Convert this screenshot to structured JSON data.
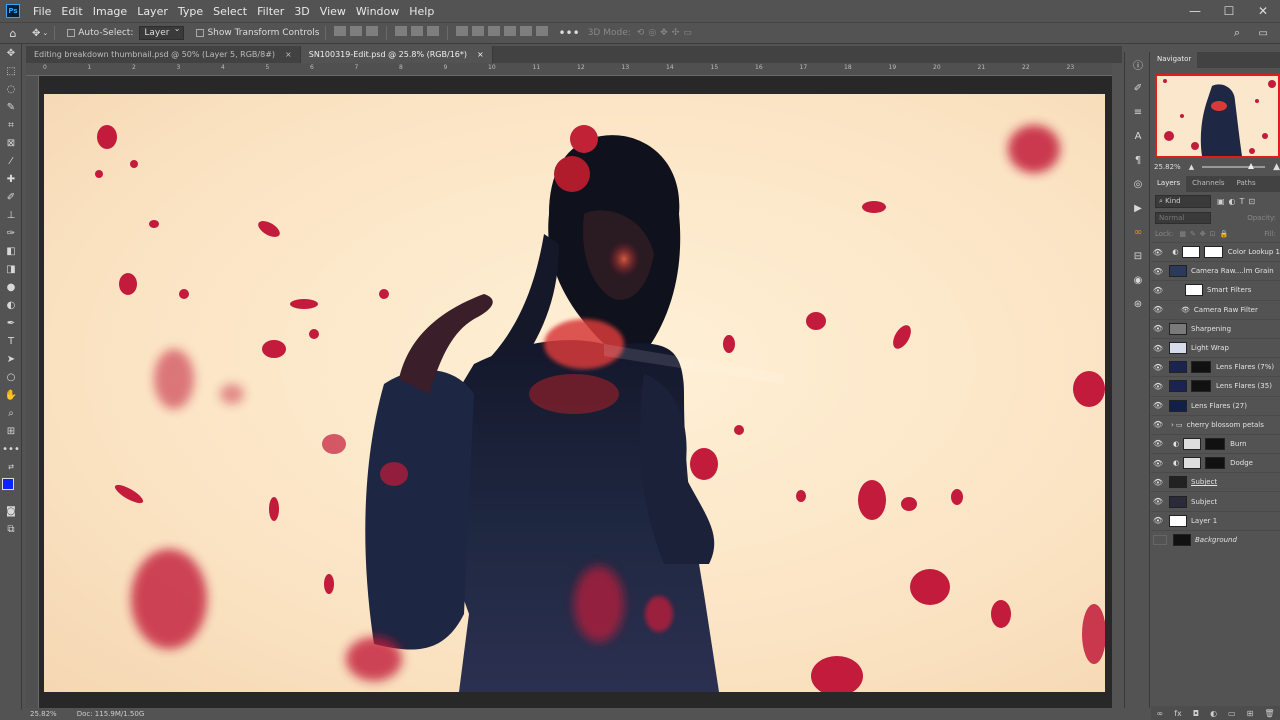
{
  "menu": [
    "File",
    "Edit",
    "Image",
    "Layer",
    "Type",
    "Select",
    "Filter",
    "3D",
    "View",
    "Window",
    "Help"
  ],
  "options": {
    "auto_select_label": "Auto-Select:",
    "auto_select_value": "Layer",
    "show_transform": "Show Transform Controls",
    "mode_3d": "3D Mode:"
  },
  "tabs": [
    {
      "label": "Editing breakdown thumbnail.psd @ 50% (Layer 5, RGB/8#)",
      "active": false
    },
    {
      "label": "SN100319-Edit.psd @ 25.8% (RGB/16*)",
      "active": true
    }
  ],
  "ruler_ticks": [
    "0",
    "1",
    "2",
    "3",
    "4",
    "5",
    "6",
    "7",
    "8",
    "9",
    "10",
    "11",
    "12",
    "13",
    "14",
    "15",
    "16",
    "17",
    "18",
    "19",
    "20",
    "21",
    "22",
    "23"
  ],
  "status": {
    "zoom": "25.82%",
    "doc": "Doc: 115.9M/1.50G"
  },
  "panels": {
    "navigator_tab": "Navigator",
    "zoom": "25.82%",
    "layer_tabs": [
      "Layers",
      "Channels",
      "Paths"
    ],
    "filter_kind": "Kind",
    "blend_mode": "Normal",
    "opacity_label": "Opacity:",
    "lock_label": "Lock:",
    "fill_label": "Fill:"
  },
  "layers": [
    {
      "name": "Color Lookup 1",
      "eye": true,
      "thumb": "#fff",
      "mask": "#fff",
      "adj": true
    },
    {
      "name": "Camera Raw....lm Grain",
      "eye": true,
      "thumb": "#2b3a5c",
      "mask": "",
      "adj": false
    },
    {
      "name": "Smart Filters",
      "eye": true,
      "thumb": "#fff",
      "mask": "",
      "adj": false,
      "indent": true
    },
    {
      "name": "Camera Raw Filter",
      "eye": true,
      "thumb": "",
      "mask": "",
      "adj": false,
      "indent": true,
      "small": true
    },
    {
      "name": "Sharpening",
      "eye": true,
      "thumb": "#7a7a7a",
      "mask": "",
      "adj": false
    },
    {
      "name": "Light Wrap",
      "eye": true,
      "thumb": "#d6dceb",
      "mask": "",
      "adj": false
    },
    {
      "name": "Lens Flares (7%)",
      "eye": true,
      "thumb": "#1b2450",
      "mask": "#111",
      "adj": false
    },
    {
      "name": "Lens Flares (35)",
      "eye": true,
      "thumb": "#1b2450",
      "mask": "#111",
      "adj": false
    },
    {
      "name": "Lens Flares (27)",
      "eye": true,
      "thumb": "#10204a",
      "mask": "",
      "adj": false
    },
    {
      "name": "cherry blossom petals",
      "eye": true,
      "thumb": "",
      "mask": "",
      "adj": false,
      "group": true
    },
    {
      "name": "Burn",
      "eye": true,
      "thumb": "#ddd",
      "mask": "#111",
      "adj": true
    },
    {
      "name": "Dodge",
      "eye": true,
      "thumb": "#ddd",
      "mask": "#111",
      "adj": true
    },
    {
      "name": "Subject",
      "eye": true,
      "thumb": "#222",
      "mask": "",
      "adj": false,
      "ul": true
    },
    {
      "name": "Subject",
      "eye": true,
      "thumb": "#2a2a3a",
      "mask": "",
      "adj": false
    },
    {
      "name": "Layer 1",
      "eye": true,
      "thumb": "#fff",
      "mask": "",
      "adj": false
    },
    {
      "name": "Background",
      "eye": false,
      "thumb": "#111",
      "mask": "",
      "adj": false,
      "italic": true
    }
  ]
}
